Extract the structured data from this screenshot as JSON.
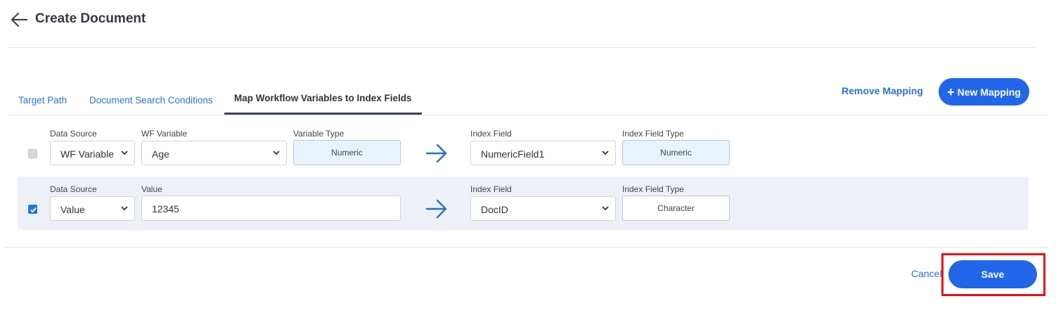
{
  "header": {
    "title": "Create Document",
    "back_icon": "arrow-left-icon"
  },
  "tabs": [
    {
      "label": "Target Path",
      "active": false
    },
    {
      "label": "Document Search Conditions",
      "active": false
    },
    {
      "label": "Map Workflow Variables to Index Fields",
      "active": true
    }
  ],
  "actions": {
    "remove_mapping": "Remove Mapping",
    "new_mapping": "New Mapping",
    "new_mapping_icon": "plus-icon"
  },
  "mappings": [
    {
      "checked": false,
      "data_source": {
        "label": "Data Source",
        "value": "WF Variable"
      },
      "wf_variable": {
        "label": "WF Variable",
        "value": "Age"
      },
      "variable_type": {
        "label": "Variable Type",
        "value": "Numeric"
      },
      "index_field": {
        "label": "Index Field",
        "value": "NumericField1"
      },
      "index_field_type": {
        "label": "Index Field Type",
        "value": "Numeric"
      }
    },
    {
      "checked": true,
      "data_source": {
        "label": "Data Source",
        "value": "Value"
      },
      "value": {
        "label": "Value",
        "value": "12345"
      },
      "index_field": {
        "label": "Index Field",
        "value": "DocID"
      },
      "index_field_type": {
        "label": "Index Field Type",
        "value": "Character"
      }
    }
  ],
  "footer": {
    "cancel": "Cancel",
    "save": "Save"
  },
  "colors": {
    "accent": "#2166e8",
    "link": "#2a72d4",
    "highlight": "#e3101d",
    "readonly_bg": "#e8f4fd",
    "selected_row_bg": "#edf1f7"
  }
}
